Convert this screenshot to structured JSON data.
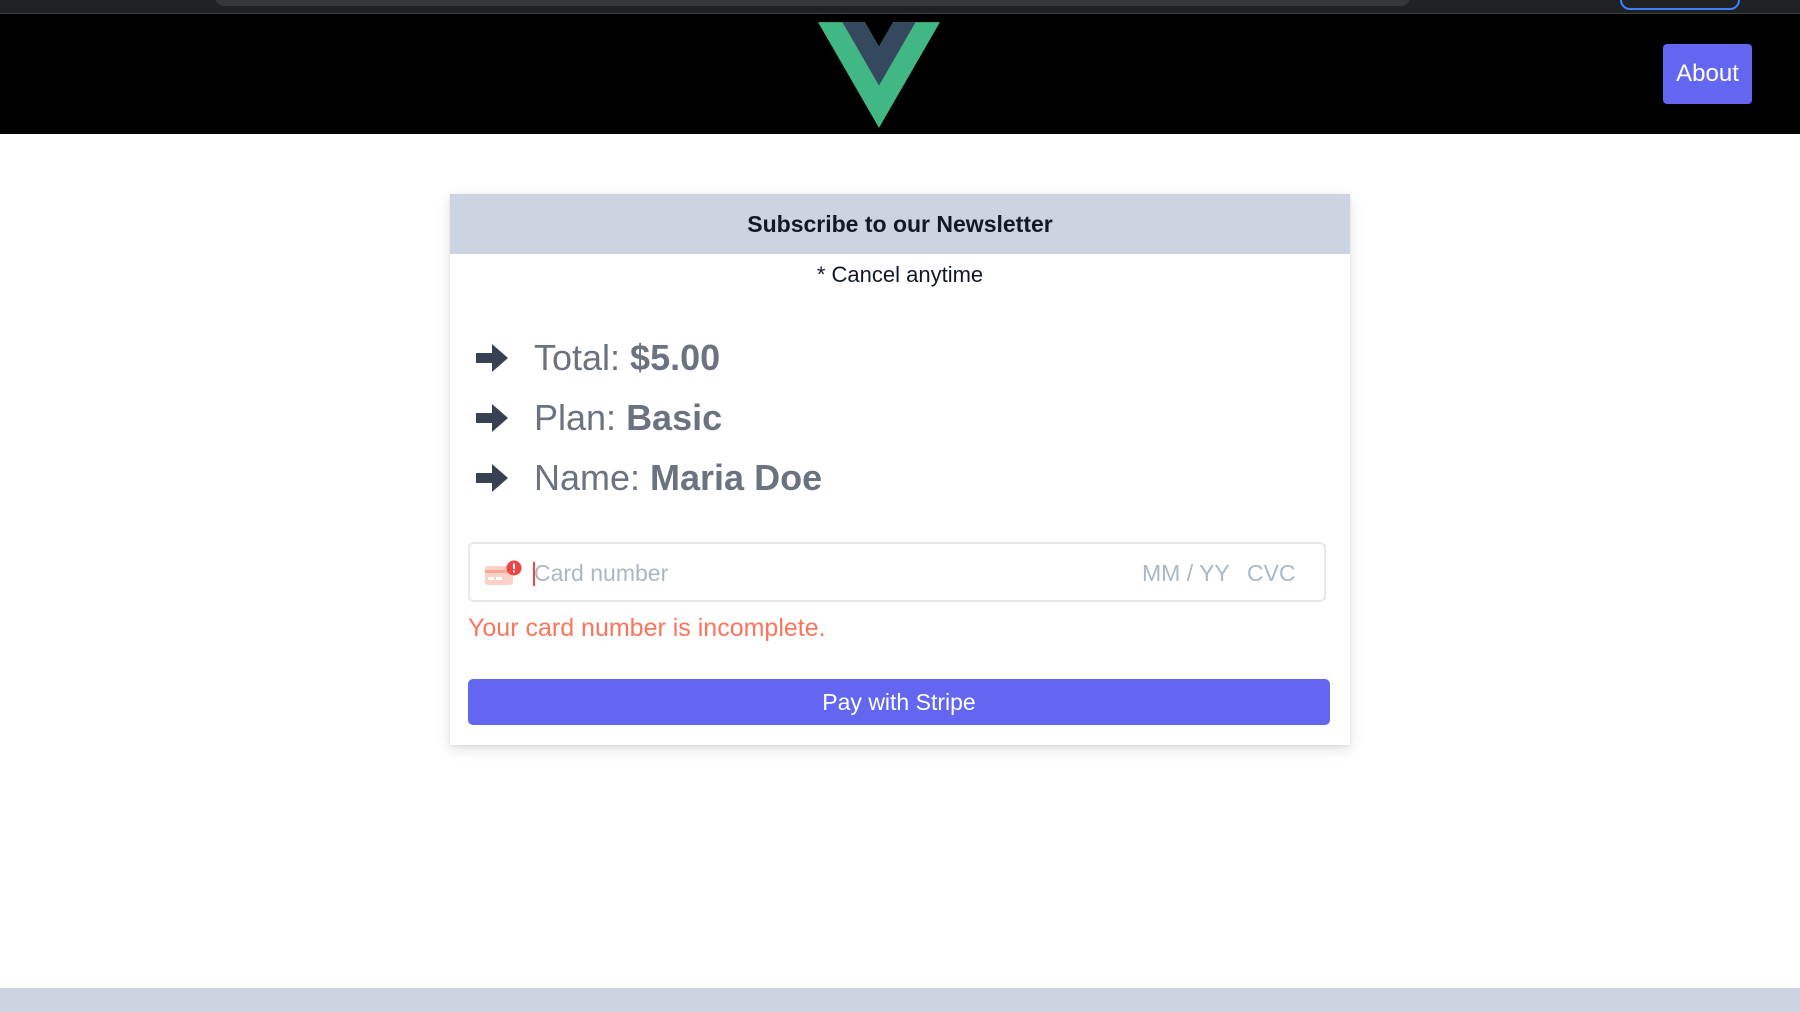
{
  "nav": {
    "about_label": "About"
  },
  "card": {
    "title": "Subscribe to our Newsletter",
    "subtitle": "* Cancel anytime",
    "items": [
      {
        "label": "Total:",
        "value": "$5.00"
      },
      {
        "label": "Plan:",
        "value": "Basic"
      },
      {
        "label": "Name:",
        "value": "Maria Doe"
      }
    ],
    "card_input": {
      "placeholder": "Card number",
      "value": "",
      "expiry_placeholder": "MM / YY",
      "cvc_placeholder": "CVC"
    },
    "error": "Your card number is incomplete.",
    "pay_label": "Pay with Stripe"
  },
  "icons": {
    "logo": "vue-logo",
    "bullet": "arrow-right-icon",
    "card": "credit-card-error-icon"
  },
  "colors": {
    "accent": "#6366f1",
    "header_bg": "#000000",
    "card_header_bg": "#cbd5e1",
    "error": "#fa755a",
    "vue_green": "#41b883",
    "vue_dark": "#34495e"
  }
}
